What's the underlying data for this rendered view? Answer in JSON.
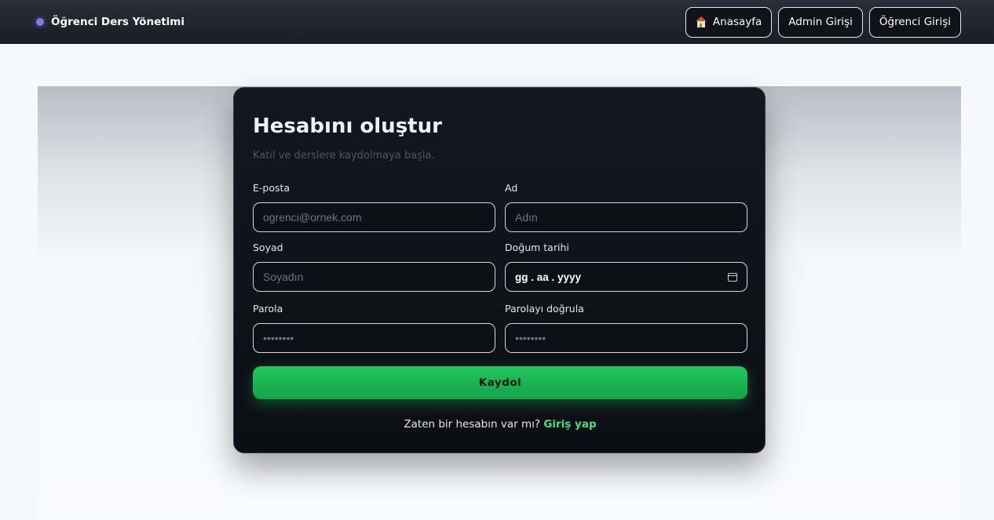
{
  "brand": {
    "title": "Öğrenci Ders Yönetimi"
  },
  "nav": {
    "home_label": "Anasayfa",
    "admin_label": "Admin Girişi",
    "student_label": "Öğrenci Girişi"
  },
  "card": {
    "title": "Hesabını oluştur",
    "subtitle": "Katıl ve derslere kaydolmaya başla."
  },
  "form": {
    "email": {
      "label": "E-posta",
      "placeholder": "ogrenci@ornek.com",
      "value": ""
    },
    "first_name": {
      "label": "Ad",
      "placeholder": "Adın",
      "value": ""
    },
    "last_name": {
      "label": "Soyad",
      "placeholder": "Soyadın",
      "value": ""
    },
    "birth_date": {
      "label": "Doğum tarihi",
      "value": "gg . aa . yyyy"
    },
    "password": {
      "label": "Parola",
      "placeholder": "••••••••",
      "value": ""
    },
    "password_confirm": {
      "label": "Parolayı doğrula",
      "placeholder": "••••••••",
      "value": ""
    },
    "submit_label": "Kaydol"
  },
  "footer": {
    "question": "Zaten bir hesabın var mı?",
    "login_link": "Giriş yap"
  },
  "colors": {
    "accent": "#22c55e",
    "link": "#4ade80",
    "card_bg": "#0f131a",
    "topbar_bg": "#1f222a"
  }
}
